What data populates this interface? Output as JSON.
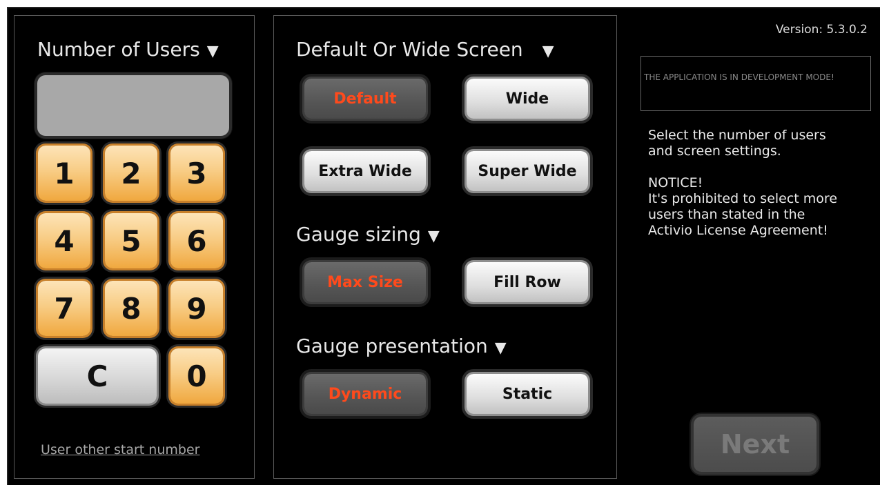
{
  "users_panel": {
    "title": "Number of Users",
    "dropdown_icon": "triangle-down",
    "display_value": "",
    "keys": [
      "1",
      "2",
      "3",
      "4",
      "5",
      "6",
      "7",
      "8",
      "9",
      "C",
      "0"
    ],
    "link": "User other start number",
    "key_color": "#f0a83f"
  },
  "screen_panel": {
    "title": "Default Or Wide Screen",
    "options": [
      "Default",
      "Wide",
      "Extra Wide",
      "Super Wide"
    ],
    "selected": "Default"
  },
  "gauge_sizing": {
    "title": "Gauge sizing",
    "options": [
      "Max Size",
      "Fill Row"
    ],
    "selected": "Max Size"
  },
  "gauge_presentation": {
    "title": "Gauge presentation",
    "options": [
      "Dynamic",
      "Static"
    ],
    "selected": "Dynamic"
  },
  "info": {
    "version": "Version: 5.3.0.2",
    "dev_mode": "THE APPLICATION IS IN DEVELOPMENT MODE!",
    "instructions": [
      "Select the number of users",
      "and screen settings."
    ],
    "notice_title": "NOTICE!",
    "notice_lines": [
      "It's prohibited to select more",
      "users than stated in the",
      "Activio License Agreement!"
    ]
  },
  "next_button": "Next",
  "colors": {
    "selected_text": "#ff4a1c",
    "background": "#000000"
  }
}
